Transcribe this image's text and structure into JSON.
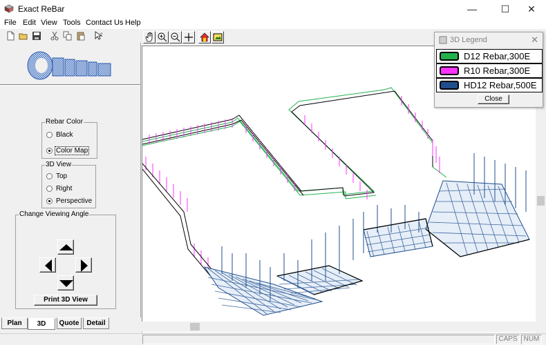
{
  "window": {
    "title": "Exact ReBar",
    "minimize": "—",
    "maximize": "☐",
    "close": "✕"
  },
  "menu": [
    "File",
    "Edit",
    "View",
    "Tools",
    "Contact Us",
    "Help"
  ],
  "rebar_color": {
    "title": "Rebar Color",
    "options": [
      {
        "label": "Black",
        "selected": false
      },
      {
        "label": "Color Map",
        "selected": true
      }
    ]
  },
  "view3d": {
    "title": "3D View",
    "options": [
      {
        "label": "Top",
        "selected": false
      },
      {
        "label": "Right",
        "selected": false
      },
      {
        "label": "Perspective",
        "selected": true
      }
    ]
  },
  "viewing_angle": {
    "title": "Change Viewing Angle",
    "print_label": "Print 3D View"
  },
  "tabs": [
    {
      "label": "Plan",
      "active": false
    },
    {
      "label": "3D",
      "active": true
    },
    {
      "label": "Quote",
      "active": false
    },
    {
      "label": "Detail",
      "active": false
    }
  ],
  "legend": {
    "title": "3D Legend",
    "close_label": "Close",
    "items": [
      {
        "label": "D12 Rebar,300E",
        "color": "#22b14c"
      },
      {
        "label": "R10 Rebar,300E",
        "color": "#ff33ff"
      },
      {
        "label": "HD12 Rebar,500E",
        "color": "#1f4e8c"
      }
    ]
  },
  "status": {
    "caps": "CAPS",
    "num": "NUM"
  }
}
